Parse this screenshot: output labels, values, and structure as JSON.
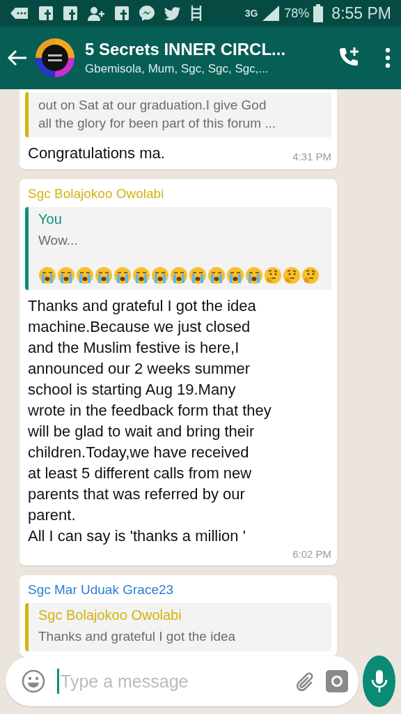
{
  "status_bar": {
    "notifications": [
      {
        "kind": "chat"
      },
      {
        "kind": "square"
      },
      {
        "kind": "square"
      },
      {
        "kind": "person-add"
      },
      {
        "kind": "square"
      },
      {
        "kind": "messenger"
      },
      {
        "kind": "bird"
      },
      {
        "kind": "ladder"
      }
    ],
    "network": "3G",
    "battery": "78%",
    "time": "8:55 PM"
  },
  "header": {
    "title": "5 Secrets INNER CIRCL...",
    "subtitle": "Gbemisola, Mum, Sgc, Sgc, Sgc,..."
  },
  "messages": [
    {
      "quote": {
        "text": "out on Sat at our graduation.I give God\nall the glory for been part of this forum ...",
        "color": "#d4b20c"
      },
      "text": "Congratulations ma.",
      "time": "4:31 PM"
    },
    {
      "sender": "Sgc Bolajokoo Owolabi",
      "color": "#d4b20c",
      "quote": {
        "author": "You",
        "text": "Wow...",
        "color": "#0b8f7a",
        "emojis": [
          {
            "kind": "crying"
          },
          {
            "kind": "crying"
          },
          {
            "kind": "crying"
          },
          {
            "kind": "crying"
          },
          {
            "kind": "crying"
          },
          {
            "kind": "crying"
          },
          {
            "kind": "crying"
          },
          {
            "kind": "crying"
          },
          {
            "kind": "crying"
          },
          {
            "kind": "crying"
          },
          {
            "kind": "crying"
          },
          {
            "kind": "crying"
          },
          {
            "kind": "thinking"
          },
          {
            "kind": "thinking"
          },
          {
            "kind": "thinking"
          }
        ]
      },
      "text": "Thanks and grateful I got the idea\nmachine.Because we just closed\nand the Muslim festive is here,I\nannounced our 2 weeks summer\nschool is starting Aug 19.Many\nwrote in the feedback form that they\nwill be glad to wait and bring their\nchildren.Today,we have received\nat least 5 different calls from new\nparents that was referred by our\nparent.\nAll I can say is 'thanks a million '",
      "time": "6:02 PM"
    },
    {
      "sender": "Sgc Mar Uduak Grace23",
      "color": "#2a7fd4",
      "quote": {
        "author": "Sgc Bolajokoo Owolabi",
        "text": "Thanks and grateful I got the idea",
        "color": "#d4b20c"
      }
    }
  ],
  "composer": {
    "placeholder": "Type a message"
  }
}
